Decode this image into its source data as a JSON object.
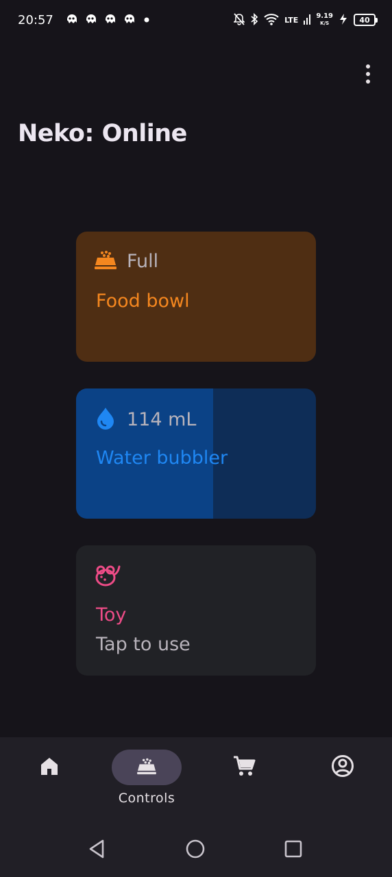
{
  "status_bar": {
    "time": "20:57",
    "network_type": "LTE",
    "net_speed_value": "9.19",
    "net_speed_unit": "K/S",
    "battery": "40"
  },
  "header": {
    "title": "Neko: Online"
  },
  "tiles": [
    {
      "id": "food",
      "icon": "food-bowl-icon",
      "status": "Full",
      "name": "Food bowl",
      "color": "#f5871f"
    },
    {
      "id": "water",
      "icon": "water-drop-icon",
      "status": "114 mL",
      "name": "Water bubbler",
      "color": "#1f87f3",
      "fill_fraction": 0.57
    },
    {
      "id": "toy",
      "icon": "mouse-toy-icon",
      "name": "Toy",
      "subtitle": "Tap to use",
      "color": "#ee4c87"
    }
  ],
  "bottom_nav": {
    "items": [
      {
        "icon": "home-icon",
        "label": ""
      },
      {
        "icon": "food-bowl-icon",
        "label": "Controls",
        "active": true
      },
      {
        "icon": "cart-icon",
        "label": ""
      },
      {
        "icon": "account-icon",
        "label": ""
      }
    ]
  },
  "colors": {
    "background": "#16141a",
    "food_tile": "#4f2e13",
    "water_tile": "#0e2d57",
    "water_fill": "#0b4286",
    "toy_tile": "#212226",
    "nav_bar": "#211f26",
    "nav_indicator": "#4a4458"
  }
}
